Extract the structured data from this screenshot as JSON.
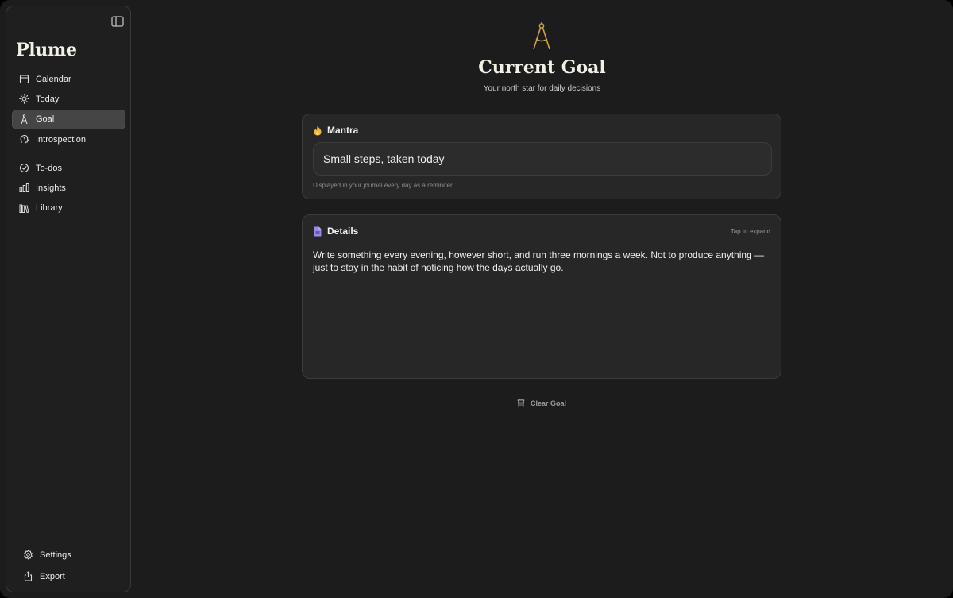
{
  "app": {
    "title": "Plume"
  },
  "sidebar": {
    "items_top": [
      {
        "label": "Calendar",
        "icon": "calendar-icon"
      },
      {
        "label": "Today",
        "icon": "sun-icon"
      },
      {
        "label": "Goal",
        "icon": "compass-icon",
        "active": true
      },
      {
        "label": "Introspection",
        "icon": "head-icon"
      }
    ],
    "items_mid": [
      {
        "label": "To-dos",
        "icon": "check-circle-icon"
      },
      {
        "label": "Insights",
        "icon": "bar-chart-icon"
      },
      {
        "label": "Library",
        "icon": "books-icon"
      }
    ],
    "items_bottom": [
      {
        "label": "Settings",
        "icon": "gear-icon"
      },
      {
        "label": "Export",
        "icon": "share-icon"
      }
    ]
  },
  "main": {
    "title": "Current Goal",
    "subtitle": "Your north star for daily decisions",
    "mantra": {
      "label": "Mantra",
      "value": "Small steps, taken today",
      "hint": "Displayed in your journal every day as a reminder"
    },
    "details": {
      "label": "Details",
      "expand_hint": "Tap to expand",
      "text": "Write something every evening, however short, and run three mornings a week. Not to produce anything — just to stay in the habit of noticing how the days actually go."
    },
    "clear_label": "Clear Goal"
  },
  "colors": {
    "accent_gold": "#c9a24a",
    "details_icon": "#9b87e8",
    "background": "#1c1c1c"
  }
}
